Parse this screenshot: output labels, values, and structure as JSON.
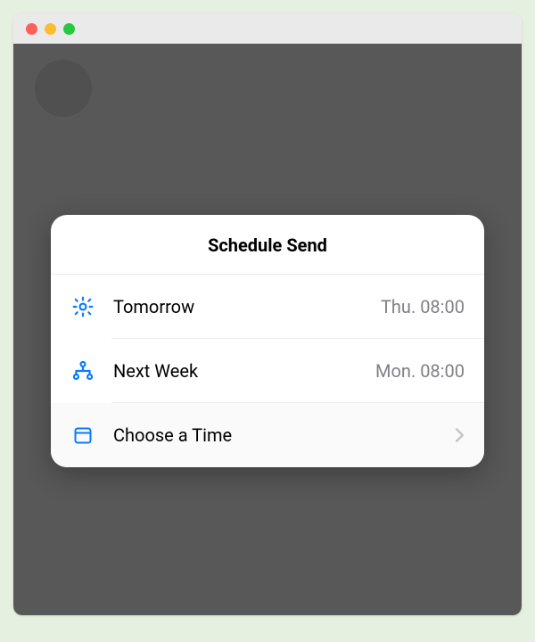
{
  "sheet": {
    "title": "Schedule Send",
    "options": [
      {
        "label": "Tomorrow",
        "time": "Thu. 08:00",
        "icon": "sun-icon"
      },
      {
        "label": "Next Week",
        "time": "Mon. 08:00",
        "icon": "sitemap-icon"
      },
      {
        "label": "Choose a Time",
        "time": "",
        "icon": "calendar-icon",
        "chevron": true
      }
    ]
  },
  "colors": {
    "accent": "#0a7aff",
    "secondary_text": "#808085",
    "overlay_bg": "#585858"
  }
}
